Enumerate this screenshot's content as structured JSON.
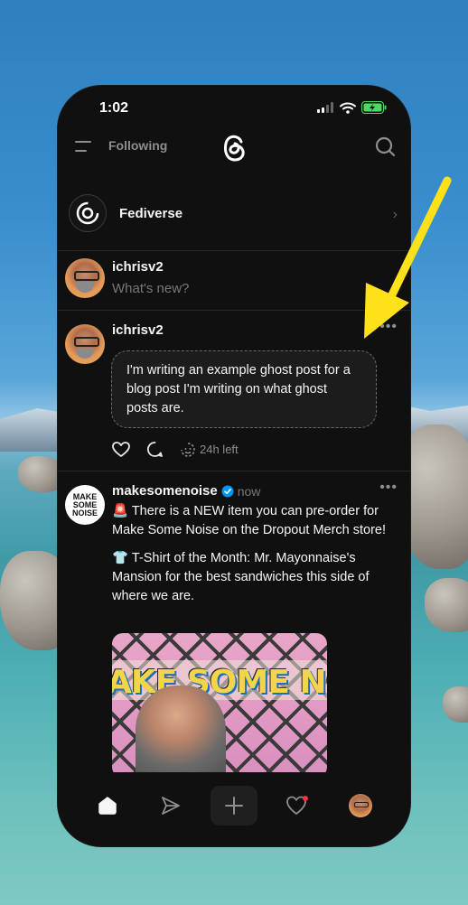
{
  "status_bar": {
    "time": "1:02"
  },
  "header": {
    "feed_label": "Following"
  },
  "fediverse": {
    "label": "Fediverse"
  },
  "compose": {
    "username": "ichrisv2",
    "placeholder": "What's new?"
  },
  "ghost_post": {
    "username": "ichrisv2",
    "text": "I'm writing an example ghost post for a blog post I'm writing on what ghost posts are.",
    "time_left": "24h left"
  },
  "post": {
    "username": "makesomenoise",
    "timestamp": "now",
    "avatar_text": "MAKE SOME NOISE",
    "paragraph1": "🚨 There is a NEW item you can pre-order for Make Some Noise on the Dropout Merch store!",
    "paragraph2": "👕 T-Shirt of the Month: Mr. Mayonnaise's Mansion for the best sandwiches this side of where we are.",
    "image_text": "AKE SOME NOI"
  },
  "icons": {
    "menu": "menu-icon",
    "logo": "threads-logo",
    "search": "search-icon",
    "fediverse": "fediverse-icon",
    "chevron": "chevron-right-icon",
    "more": "more-icon",
    "like": "heart-icon",
    "reply": "comment-icon",
    "timer": "ghost-timer-icon",
    "verified": "verified-badge-icon",
    "home": "home-icon",
    "send": "send-icon",
    "new": "plus-icon",
    "activity": "activity-heart-icon",
    "profile": "profile-avatar"
  },
  "colors": {
    "background": "#101010",
    "accent_arrow": "#ffe11a",
    "verified": "#0095f6",
    "notification": "#ff3040"
  }
}
